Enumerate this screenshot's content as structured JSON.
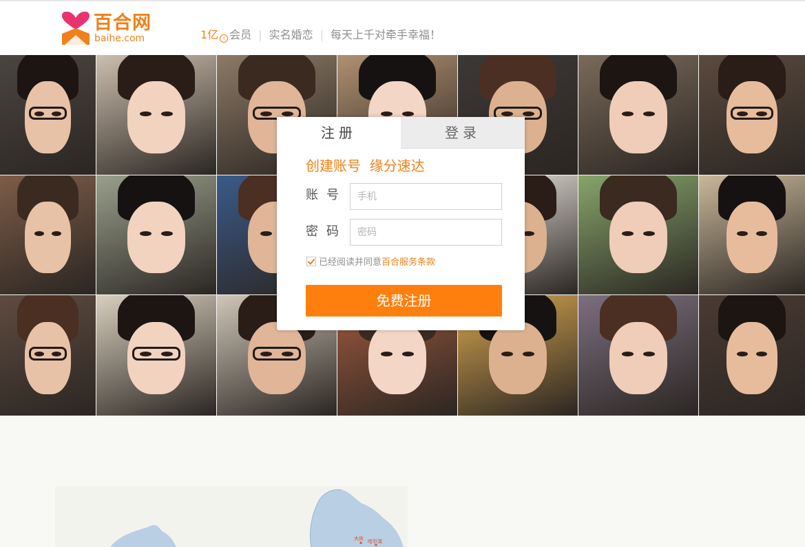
{
  "header": {
    "logo_cn": "百合网",
    "logo_en": "baihe.com",
    "slogan": {
      "members_count": "1亿",
      "members_label": "会员",
      "item2": "实名婚恋",
      "item3": "每天上千对牵手幸福！"
    }
  },
  "panel": {
    "tab_register": "注册",
    "tab_login": "登录",
    "title": "创建账号  缘分速达",
    "account_label": "账号",
    "account_placeholder": "手机",
    "password_label": "密码",
    "password_placeholder": "密码",
    "agree_checked": true,
    "agree_text": "已经阅读并同意",
    "terms_link": "百合服务条款",
    "submit_label": "免费注册"
  },
  "map": {
    "city_labels": [
      "大庆",
      "哈尔滨"
    ]
  },
  "colors": {
    "brand": "#f08119",
    "button": "#ff7f0e",
    "logo_pink": "#e8336f"
  }
}
